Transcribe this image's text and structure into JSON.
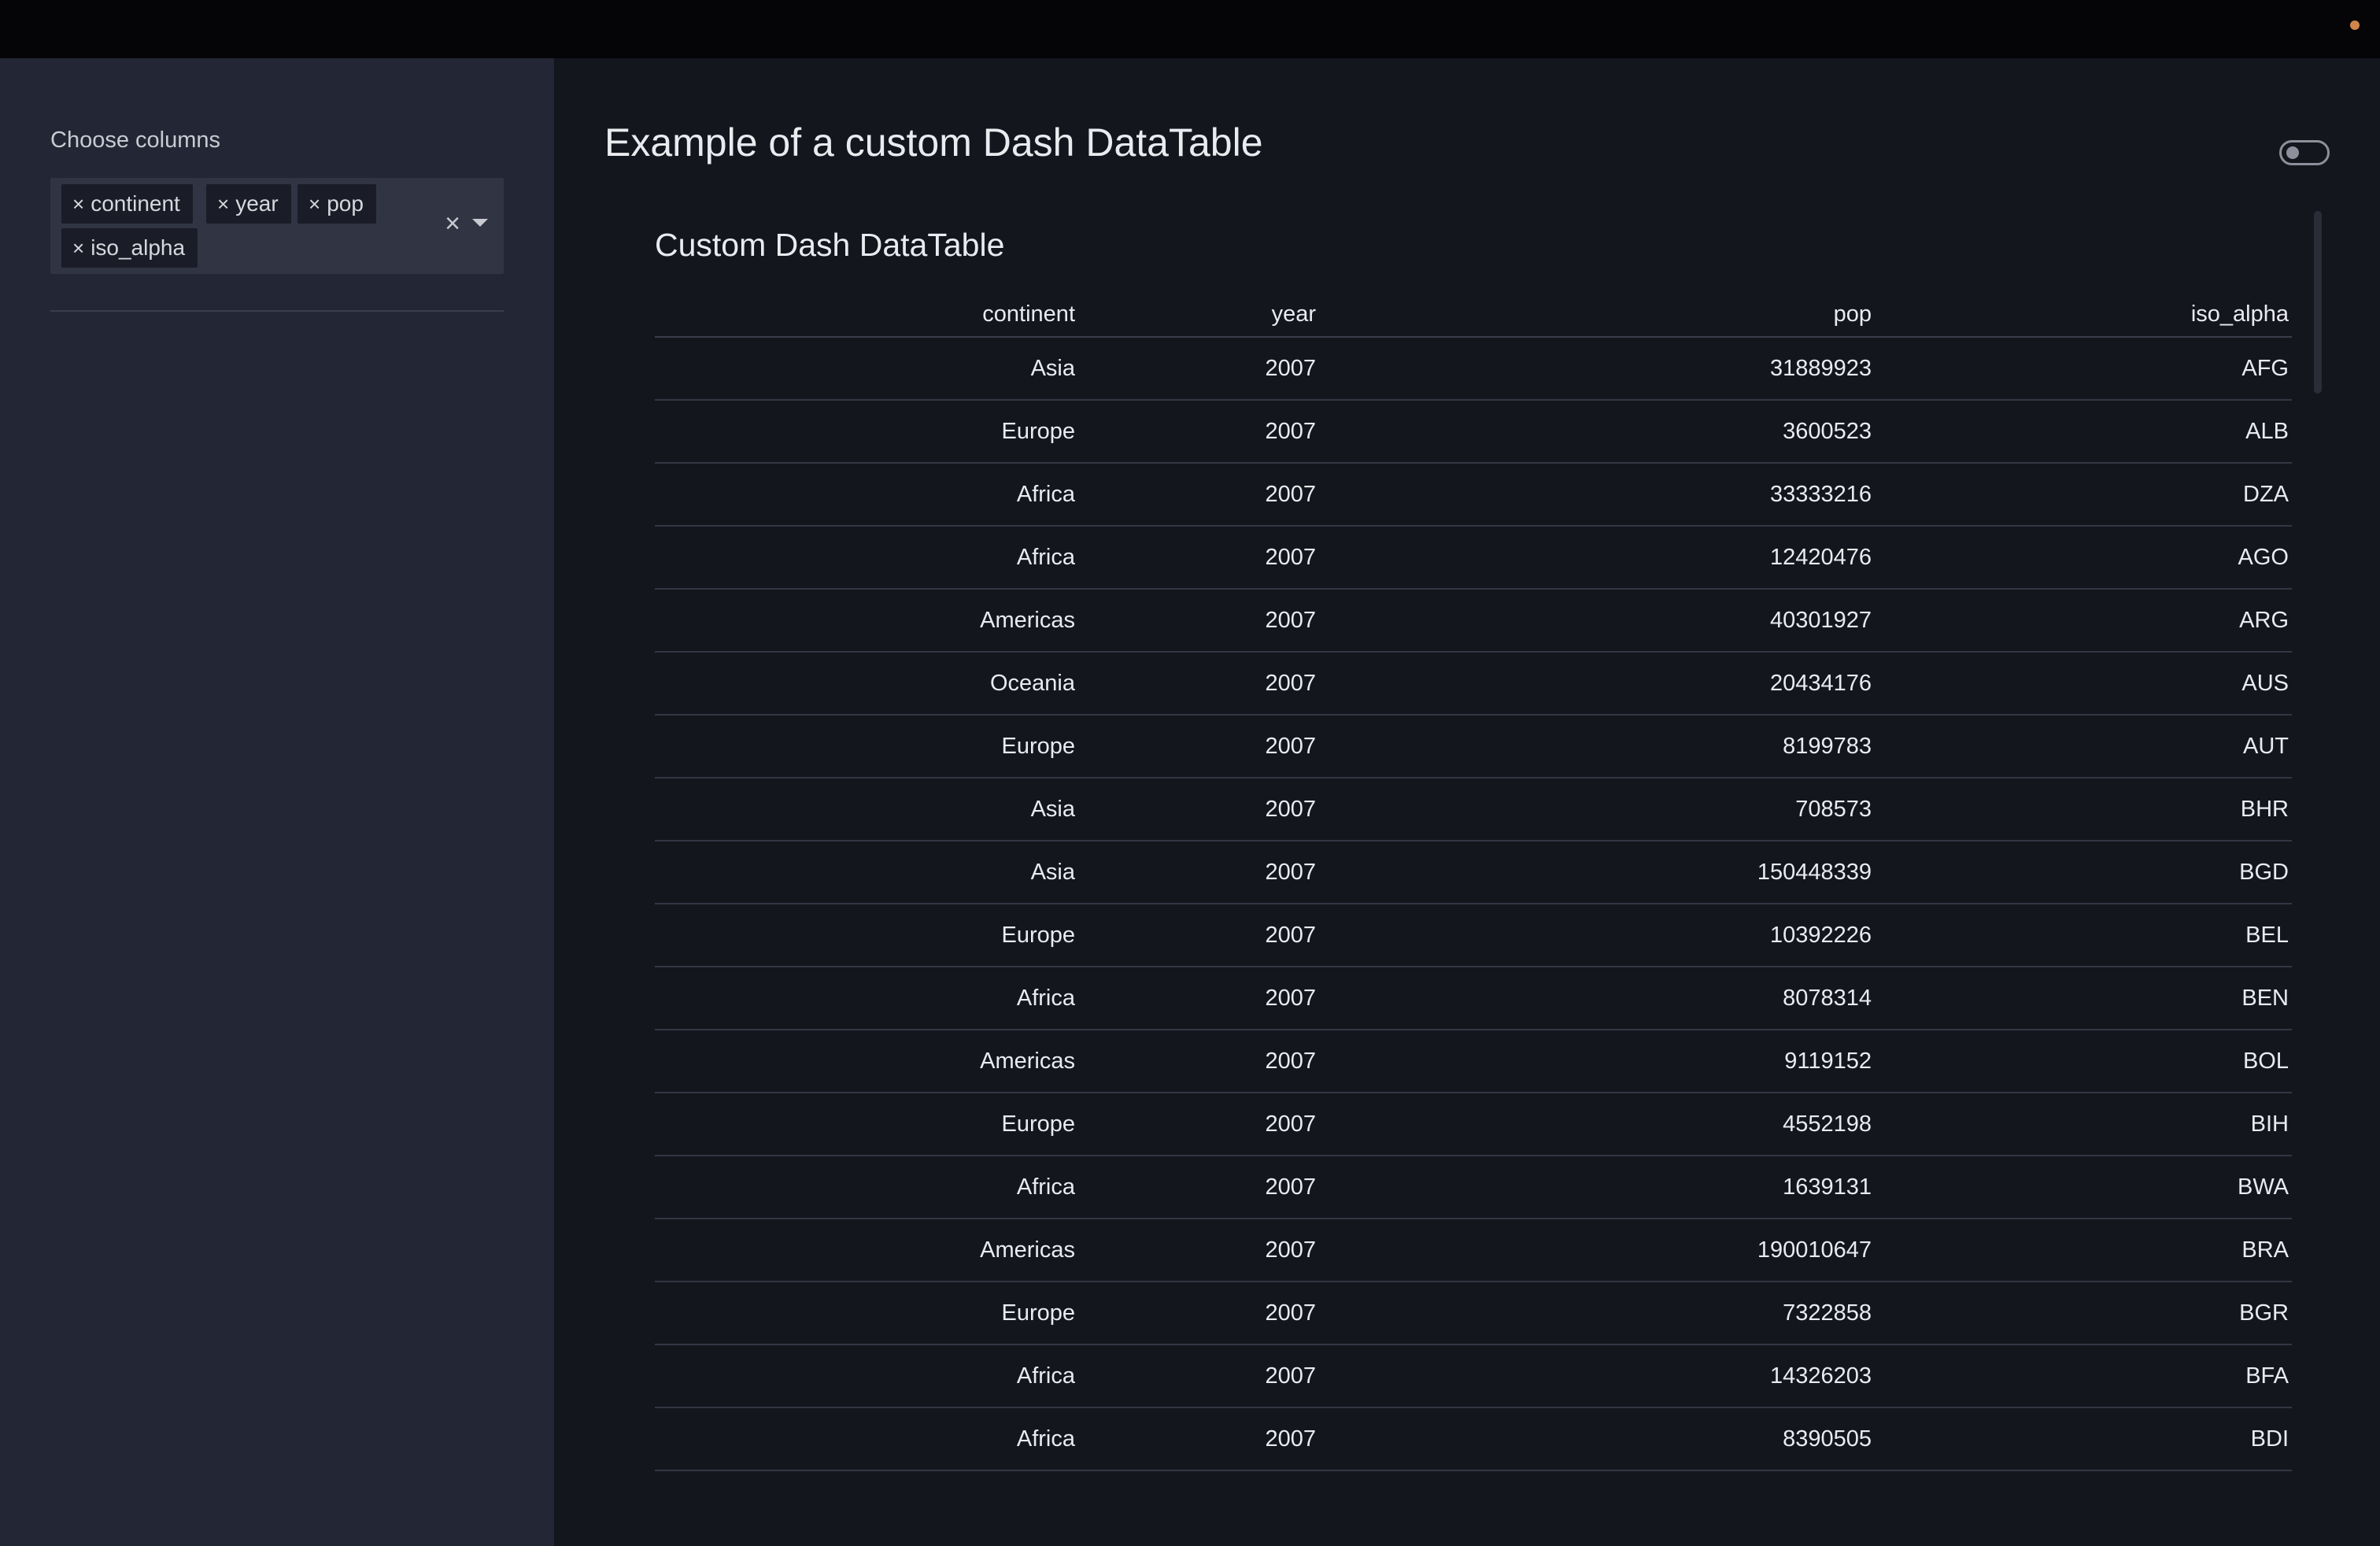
{
  "sidebar": {
    "label": "Choose columns",
    "selected_columns": [
      "continent",
      "year",
      "pop",
      "iso_alpha"
    ],
    "chip_remove_glyph": "×",
    "clear_glyph": "×"
  },
  "main": {
    "title": "Example of a custom Dash DataTable",
    "table_title": "Custom Dash DataTable",
    "toggle_on": false
  },
  "table": {
    "headers": [
      "continent",
      "year",
      "pop",
      "iso_alpha"
    ],
    "rows": [
      [
        "Asia",
        "2007",
        "31889923",
        "AFG"
      ],
      [
        "Europe",
        "2007",
        "3600523",
        "ALB"
      ],
      [
        "Africa",
        "2007",
        "33333216",
        "DZA"
      ],
      [
        "Africa",
        "2007",
        "12420476",
        "AGO"
      ],
      [
        "Americas",
        "2007",
        "40301927",
        "ARG"
      ],
      [
        "Oceania",
        "2007",
        "20434176",
        "AUS"
      ],
      [
        "Europe",
        "2007",
        "8199783",
        "AUT"
      ],
      [
        "Asia",
        "2007",
        "708573",
        "BHR"
      ],
      [
        "Asia",
        "2007",
        "150448339",
        "BGD"
      ],
      [
        "Europe",
        "2007",
        "10392226",
        "BEL"
      ],
      [
        "Africa",
        "2007",
        "8078314",
        "BEN"
      ],
      [
        "Americas",
        "2007",
        "9119152",
        "BOL"
      ],
      [
        "Europe",
        "2007",
        "4552198",
        "BIH"
      ],
      [
        "Africa",
        "2007",
        "1639131",
        "BWA"
      ],
      [
        "Americas",
        "2007",
        "190010647",
        "BRA"
      ],
      [
        "Europe",
        "2007",
        "7322858",
        "BGR"
      ],
      [
        "Africa",
        "2007",
        "14326203",
        "BFA"
      ],
      [
        "Africa",
        "2007",
        "8390505",
        "BDI"
      ]
    ]
  },
  "colors": {
    "topbar": "#050507",
    "sidebar": "#232735",
    "main": "#14161e",
    "status_dot": "#d0864a"
  }
}
